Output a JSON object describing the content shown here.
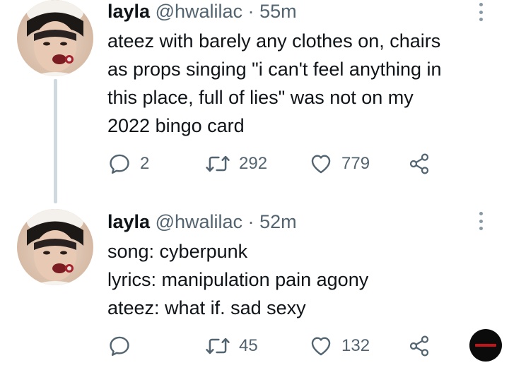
{
  "tweets": [
    {
      "name": "layla",
      "handle": "@hwalilac",
      "separator": "·",
      "time": "55m",
      "text_lines": [
        "ateez with barely any clothes on, chairs",
        "as props singing \"i can't feel anything in",
        "this place, full of lies\" was not on my",
        "2022 bingo card"
      ],
      "reply_count": "2",
      "retweet_count": "292",
      "like_count": "779"
    },
    {
      "name": "layla",
      "handle": "@hwalilac",
      "separator": "·",
      "time": "52m",
      "text_lines": [
        "song: cyberpunk",
        "lyrics: manipulation pain agony",
        "ateez: what if. sad sexy"
      ],
      "reply_count": "",
      "retweet_count": "45",
      "like_count": "132"
    }
  ],
  "icons": {
    "reply": "reply-icon",
    "retweet": "retweet-icon",
    "like": "heart-icon",
    "share": "share-icon",
    "more": "more-vertical-icon",
    "watermark": "watermark-logo"
  },
  "colors": {
    "text": "#0f1419",
    "secondary": "#536471",
    "thread_line": "#cfd9de"
  }
}
